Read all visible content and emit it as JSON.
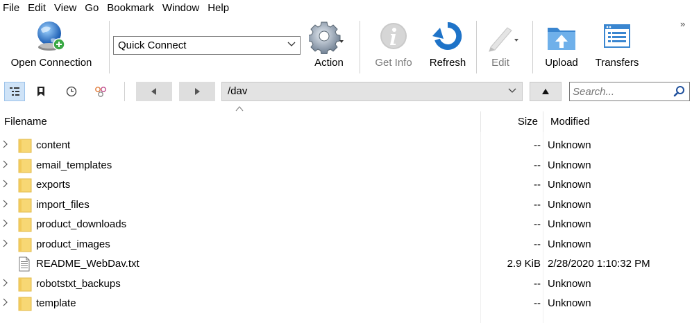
{
  "menu": [
    "File",
    "Edit",
    "View",
    "Go",
    "Bookmark",
    "Window",
    "Help"
  ],
  "toolbar": {
    "open_connection": "Open Connection",
    "quick_connect": "Quick Connect",
    "action": "Action",
    "get_info": "Get Info",
    "refresh": "Refresh",
    "edit": "Edit",
    "upload": "Upload",
    "transfers": "Transfers",
    "overflow": "»"
  },
  "nav": {
    "path": "/dav",
    "search_placeholder": "Search..."
  },
  "columns": {
    "filename": "Filename",
    "size": "Size",
    "modified": "Modified"
  },
  "files": [
    {
      "name": "content",
      "size": "--",
      "modified": "Unknown",
      "type": "folder"
    },
    {
      "name": "email_templates",
      "size": "--",
      "modified": "Unknown",
      "type": "folder"
    },
    {
      "name": "exports",
      "size": "--",
      "modified": "Unknown",
      "type": "folder"
    },
    {
      "name": "import_files",
      "size": "--",
      "modified": "Unknown",
      "type": "folder"
    },
    {
      "name": "product_downloads",
      "size": "--",
      "modified": "Unknown",
      "type": "folder"
    },
    {
      "name": "product_images",
      "size": "--",
      "modified": "Unknown",
      "type": "folder"
    },
    {
      "name": "README_WebDav.txt",
      "size": "2.9 KiB",
      "modified": "2/28/2020 1:10:32 PM",
      "type": "file"
    },
    {
      "name": "robotstxt_backups",
      "size": "--",
      "modified": "Unknown",
      "type": "folder"
    },
    {
      "name": "template",
      "size": "--",
      "modified": "Unknown",
      "type": "folder"
    }
  ],
  "colors": {
    "folder": "#f7d774",
    "folder_edge": "#e0b94a",
    "accent_blue": "#1e73c8",
    "disabled_text": "#7a7a7a"
  }
}
